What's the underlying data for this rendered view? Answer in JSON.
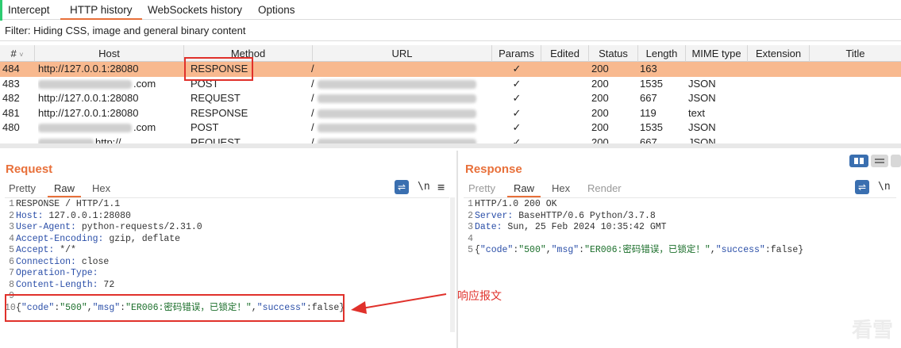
{
  "tabs": [
    {
      "label": "Intercept",
      "active": false
    },
    {
      "label": "HTTP history",
      "active": true
    },
    {
      "label": "WebSockets history",
      "active": false
    },
    {
      "label": "Options",
      "active": false
    }
  ],
  "filter": "Filter: Hiding CSS, image and general binary content",
  "columns": [
    "#",
    "Host",
    "Method",
    "URL",
    "Params",
    "Edited",
    "Status",
    "Length",
    "MIME type",
    "Extension",
    "Title"
  ],
  "rows": [
    {
      "num": "484",
      "host": "http://127.0.0.1:28080",
      "host_blurred": false,
      "method": "RESPONSE",
      "url": "/",
      "url_blurred": false,
      "params": "✓",
      "status": "200",
      "length": "163",
      "mime": "",
      "selected": true
    },
    {
      "num": "483",
      "host": ".com",
      "host_blurred": true,
      "method": "POST",
      "url": "/",
      "url_blurred": true,
      "params": "✓",
      "status": "200",
      "length": "1535",
      "mime": "JSON",
      "selected": false
    },
    {
      "num": "482",
      "host": "http://127.0.0.1:28080",
      "host_blurred": false,
      "method": "REQUEST",
      "url": "/",
      "url_blurred": true,
      "params": "✓",
      "status": "200",
      "length": "667",
      "mime": "JSON",
      "selected": false
    },
    {
      "num": "481",
      "host": "http://127.0.0.1:28080",
      "host_blurred": false,
      "method": "RESPONSE",
      "url": "/",
      "url_blurred": true,
      "params": "✓",
      "status": "200",
      "length": "119",
      "mime": "text",
      "selected": false
    },
    {
      "num": "480",
      "host": ".com",
      "host_blurred": true,
      "method": "POST",
      "url": "/",
      "url_blurred": true,
      "params": "✓",
      "status": "200",
      "length": "1535",
      "mime": "JSON",
      "selected": false
    },
    {
      "num": "",
      "host": "http://",
      "host_blurred": true,
      "method": "REQUEST",
      "url": "/",
      "url_blurred": true,
      "params": "✓",
      "status": "200",
      "length": "667",
      "mime": "JSON",
      "selected": false
    }
  ],
  "request": {
    "title": "Request",
    "subtabs": [
      "Pretty",
      "Raw",
      "Hex"
    ],
    "active_subtab": "Raw",
    "lines": [
      {
        "n": "1",
        "text": "RESPONSE / HTTP/1.1",
        "kind": "plain"
      },
      {
        "n": "2",
        "key": "Host",
        "value": " 127.0.0.1:28080",
        "kind": "header"
      },
      {
        "n": "3",
        "key": "User-Agent",
        "value": " python-requests/2.31.0",
        "kind": "header"
      },
      {
        "n": "4",
        "key": "Accept-Encoding",
        "value": " gzip, deflate",
        "kind": "header"
      },
      {
        "n": "5",
        "key": "Accept",
        "value": " */*",
        "kind": "header"
      },
      {
        "n": "6",
        "key": "Connection",
        "value": " close",
        "kind": "header"
      },
      {
        "n": "7",
        "key": "Operation-Type",
        "value": "",
        "kind": "header"
      },
      {
        "n": "8",
        "key": "Content-Length",
        "value": " 72",
        "kind": "header"
      },
      {
        "n": "9",
        "text": "",
        "kind": "plain"
      },
      {
        "n": "10",
        "kind": "json",
        "code": "500",
        "msg": "ER006:密码错误，已锁定！",
        "success": "false"
      }
    ]
  },
  "response": {
    "title": "Response",
    "subtabs": [
      "Pretty",
      "Raw",
      "Hex",
      "Render"
    ],
    "active_subtab": "Raw",
    "lines": [
      {
        "n": "1",
        "text": "HTTP/1.0 200 OK",
        "kind": "plain"
      },
      {
        "n": "2",
        "key": "Server",
        "value": " BaseHTTP/0.6 Python/3.7.8",
        "kind": "header"
      },
      {
        "n": "3",
        "key": "Date",
        "value": " Sun, 25 Feb 2024 10:35:42 GMT",
        "kind": "header"
      },
      {
        "n": "4",
        "text": "",
        "kind": "plain"
      },
      {
        "n": "5",
        "kind": "json",
        "code": "500",
        "msg": "ER006:密码错误，已锁定！",
        "success": "false"
      }
    ]
  },
  "tools": {
    "newline": "\\n",
    "menu": "≡"
  },
  "annotation": "响应报文",
  "watermark": "看雪",
  "colors": {
    "accent": "#e8703a",
    "selected_row": "#f8b98f",
    "highlight_box": "#e0312b",
    "header_key": "#2a4ea8"
  }
}
